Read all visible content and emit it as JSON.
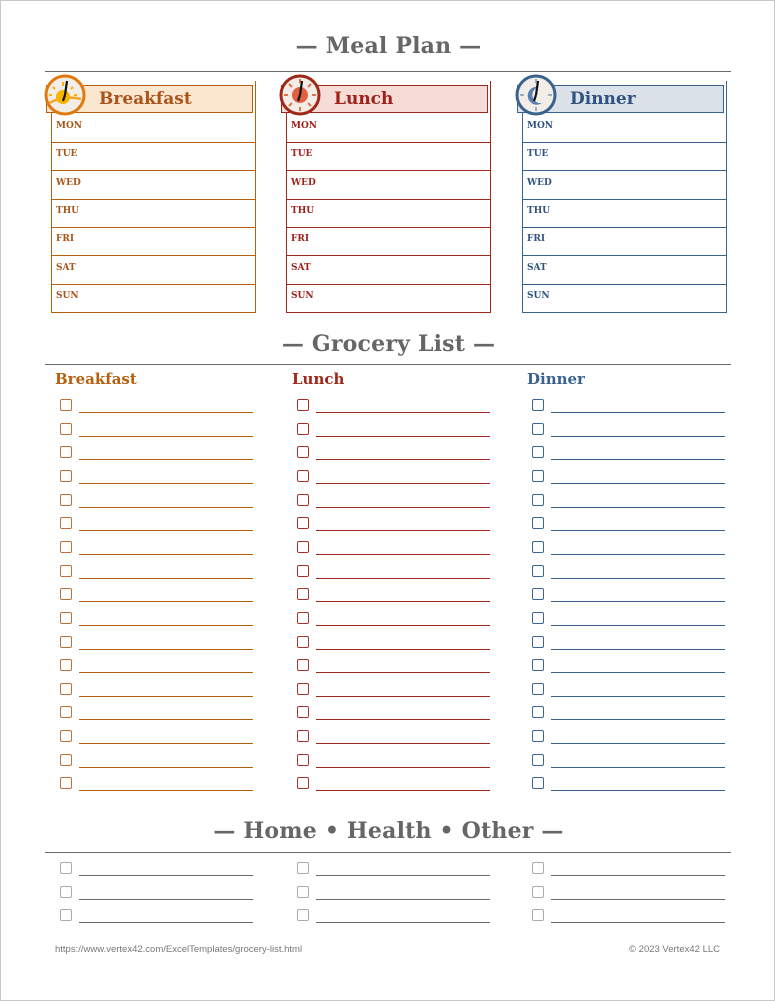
{
  "meal_plan": {
    "title": "— Meal Plan —",
    "days": [
      "MON",
      "TUE",
      "WED",
      "THU",
      "FRI",
      "SAT",
      "SUN"
    ],
    "columns": [
      {
        "key": "breakfast",
        "label": "Breakfast",
        "icon": "sunrise-clock-icon",
        "color": "#b5600f",
        "fill": "#fbe6d0",
        "text": "#a8541a"
      },
      {
        "key": "lunch",
        "label": "Lunch",
        "icon": "sun-clock-icon",
        "color": "#a02818",
        "fill": "#f6dcd6",
        "text": "#a0201a"
      },
      {
        "key": "dinner",
        "label": "Dinner",
        "icon": "moon-clock-icon",
        "color": "#3a6290",
        "fill": "#dbe2ea",
        "text": "#2f5280"
      }
    ]
  },
  "grocery_list": {
    "title": "— Grocery List —",
    "rows_per_column": 17,
    "columns": [
      {
        "label": "Breakfast",
        "color": "#b5600f",
        "box": "#c0703a"
      },
      {
        "label": "Lunch",
        "color": "#a02818",
        "box": "#a8302a"
      },
      {
        "label": "Dinner",
        "color": "#3a6290",
        "box": "#3d6595"
      }
    ]
  },
  "other_list": {
    "title": "— Home • Health • Other —",
    "rows_per_column": 3,
    "color": "#6a6a6a",
    "box": "#aaaaaa"
  },
  "footer": {
    "url": "https://www.vertex42.com/ExcelTemplates/grocery-list.html",
    "copyright": "© 2023 Vertex42 LLC"
  }
}
